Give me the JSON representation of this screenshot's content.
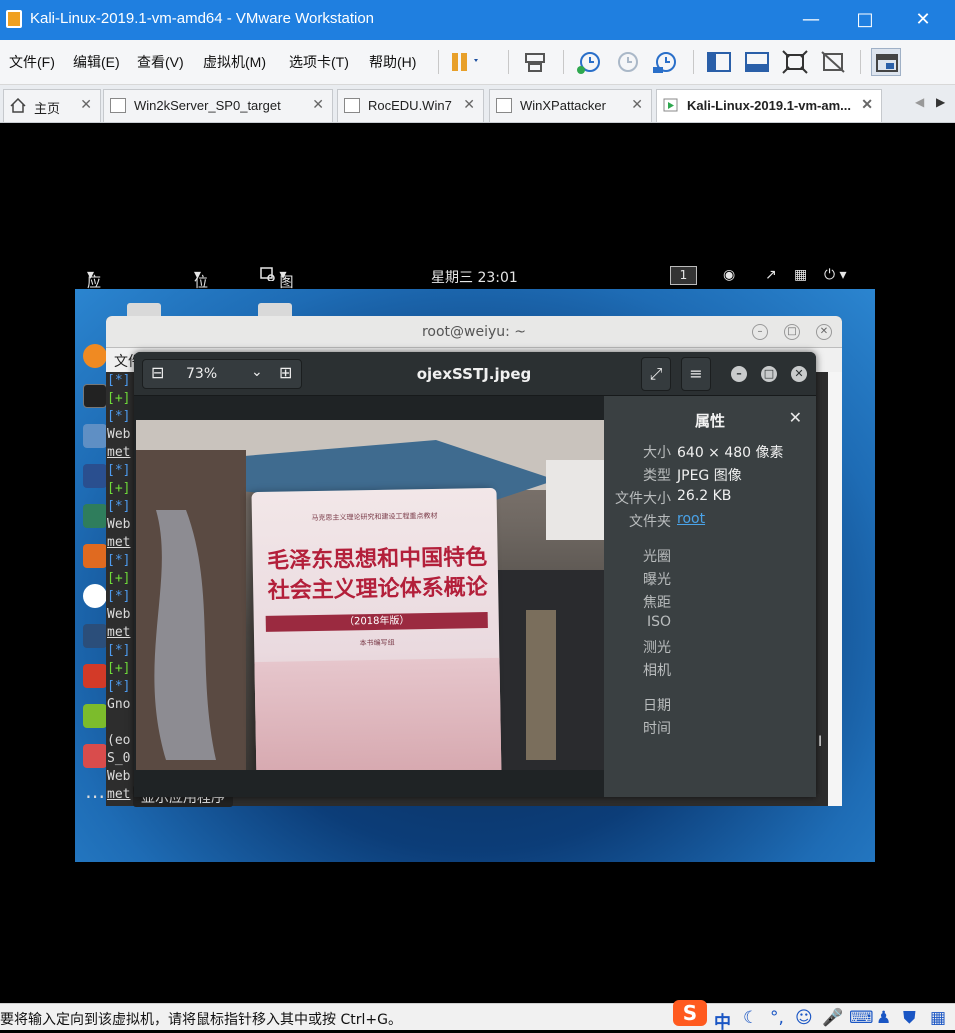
{
  "window": {
    "title": "Kali-Linux-2019.1-vm-amd64 - VMware Workstation"
  },
  "menu": [
    "文件(F)",
    "编辑(E)",
    "查看(V)",
    "虚拟机(M)",
    "选项卡(T)",
    "帮助(H)"
  ],
  "tabs": [
    {
      "label": "主页"
    },
    {
      "label": "Win2kServer_SP0_target"
    },
    {
      "label": "RocEDU.Win7"
    },
    {
      "label": "WinXPattacker"
    },
    {
      "label": "Kali-Linux-2019.1-vm-am..."
    }
  ],
  "gnome": {
    "apps_menu": "应用程序",
    "places_menu": "位置",
    "current_app": "图像查看器",
    "clock": "星期三 23:01",
    "workspace": "1"
  },
  "terminal": {
    "title": "root@weiyu: ~",
    "menu_first": "文件",
    "lines": [
      "[*]",
      "[+]",
      "[*]",
      "Web",
      "met",
      "[*]",
      "[+]",
      "[*]",
      "Web",
      "met",
      "[*]",
      "[+]",
      "[*]",
      "Web",
      "met",
      "[*]",
      "[+]",
      "[*]",
      "Gno",
      "",
      "(eo",
      "S_0",
      "Web",
      "met"
    ],
    "show_apps_tooltip": "显示应用程序"
  },
  "viewer": {
    "zoom": "73%",
    "filename": "ojexSSTJ.jpeg",
    "props_title": "属性",
    "props": [
      {
        "key": "大小",
        "value": "640 × 480 像素"
      },
      {
        "key": "类型",
        "value": "JPEG 图像"
      },
      {
        "key": "文件大小",
        "value": "26.2 KB"
      },
      {
        "key": "文件夹",
        "value": "root"
      }
    ],
    "exif_labels": [
      "光圈",
      "曝光",
      "焦距",
      "ISO",
      "测光",
      "相机"
    ],
    "date_labels": [
      "日期",
      "时间"
    ],
    "book": {
      "top_line": "马克思主义理论研究和建设工程重点教材",
      "title_line1": "毛泽东思想和中国特色",
      "title_line2": "社会主义理论体系概论",
      "edition": "（2018年版）",
      "author": "本书编写组"
    }
  },
  "statusbar": {
    "message": "要将输入定向到该虚拟机，请将鼠标指针移入其中或按 Ctrl+G。"
  }
}
